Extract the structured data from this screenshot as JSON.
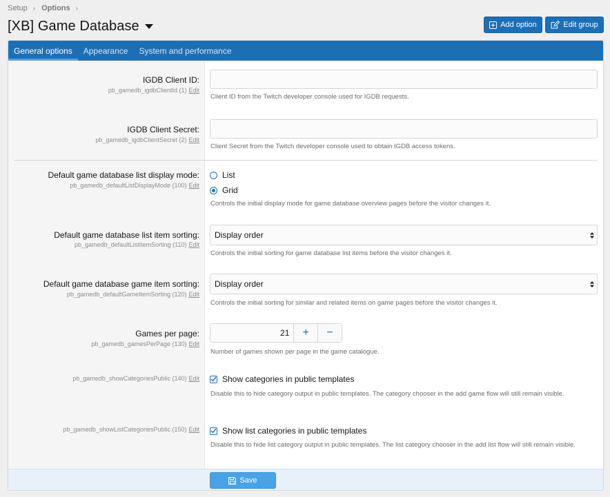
{
  "breadcrumb": {
    "items": [
      "Setup",
      "Options"
    ]
  },
  "page": {
    "title": "[XB] Game Database"
  },
  "actions": {
    "add_option": "Add option",
    "edit_group": "Edit group"
  },
  "tabs": [
    {
      "label": "General options",
      "active": true
    },
    {
      "label": "Appearance",
      "active": false
    },
    {
      "label": "System and performance",
      "active": false
    }
  ],
  "options": {
    "client_id": {
      "label": "IGDB Client ID:",
      "key": "pb_gamedb_igdbClientId (1)",
      "edit": "Edit",
      "value": "",
      "description": "Client ID from the Twitch developer console used for IGDB requests."
    },
    "client_secret": {
      "label": "IGDB Client Secret:",
      "key": "pb_gamedb_igdbClientSecret (2)",
      "edit": "Edit",
      "value": "",
      "description": "Client Secret from the Twitch developer console used to obtain IGDB access tokens."
    },
    "display_mode": {
      "label": "Default game database list display mode:",
      "key": "pb_gamedb_defaultListDisplayMode (100)",
      "edit": "Edit",
      "choices": [
        {
          "label": "List",
          "checked": false
        },
        {
          "label": "Grid",
          "checked": true
        }
      ],
      "description": "Controls the initial display mode for game database overview pages before the visitor changes it."
    },
    "list_sorting": {
      "label": "Default game database list item sorting:",
      "key": "pb_gamedb_defaultListItemSorting (110)",
      "edit": "Edit",
      "selected": "Display order",
      "description": "Controls the initial sorting for game database list items before the visitor changes it."
    },
    "game_sorting": {
      "label": "Default game database game item sorting:",
      "key": "pb_gamedb_defaultGameItemSorting (120)",
      "edit": "Edit",
      "selected": "Display order",
      "description": "Controls the initial sorting for similar and related items on game pages before the visitor changes it."
    },
    "games_per_page": {
      "label": "Games per page:",
      "key": "pb_gamedb_gamesPerPage (130)",
      "edit": "Edit",
      "value": "21",
      "plus": "+",
      "minus": "−",
      "description": "Number of games shown per page in the game catalogue."
    },
    "show_categories": {
      "key": "pb_gamedb_showCategoriesPublic (140)",
      "edit": "Edit",
      "checkbox_label": "Show categories in public templates",
      "checked": true,
      "description": "Disable this to hide category output in public templates. The category chooser in the add game flow will still remain visible."
    },
    "show_list_categories": {
      "key": "pb_gamedb_showListCategoriesPublic (150)",
      "edit": "Edit",
      "checkbox_label": "Show list categories in public templates",
      "checked": true,
      "description": "Disable this to hide list category output in public templates. The list category chooser in the add list flow will still remain visible."
    }
  },
  "footer": {
    "save": "Save"
  },
  "colors": {
    "accent": "#1d6fb5",
    "save": "#4aa2e6",
    "label_bg": "#f5f5f5"
  },
  "icons": {
    "add": "plus-square-icon",
    "edit": "edit-icon",
    "save": "save-icon",
    "caret": "caret-down-icon"
  }
}
